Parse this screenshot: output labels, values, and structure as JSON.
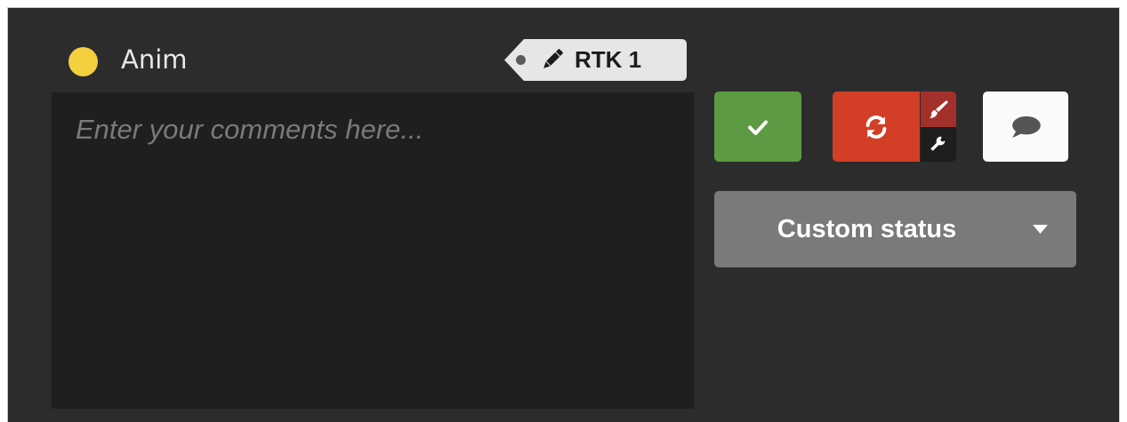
{
  "task": {
    "name": "Anim",
    "status_color": "#f4d03f"
  },
  "revision": {
    "label": "RTK 1",
    "icon": "pencil-icon"
  },
  "comment": {
    "placeholder": "Enter your comments here...",
    "value": ""
  },
  "actions": {
    "validate": {
      "icon": "check-icon",
      "color": "#5c9b44"
    },
    "retake": {
      "icon": "refresh-icon",
      "color": "#d33e26"
    },
    "paint": {
      "icon": "brush-icon",
      "color": "#a3302a"
    },
    "tools": {
      "icon": "wrench-icon",
      "color": "#1e1e1e"
    },
    "comment": {
      "icon": "speech-bubble-icon",
      "color": "#fafafa"
    }
  },
  "status_select": {
    "selected": "Custom status",
    "icon": "caret-down-icon"
  },
  "colors": {
    "panel_bg": "#2c2c2c",
    "textarea_bg": "#1f1f1f",
    "status_bg": "#7a7a7a"
  }
}
